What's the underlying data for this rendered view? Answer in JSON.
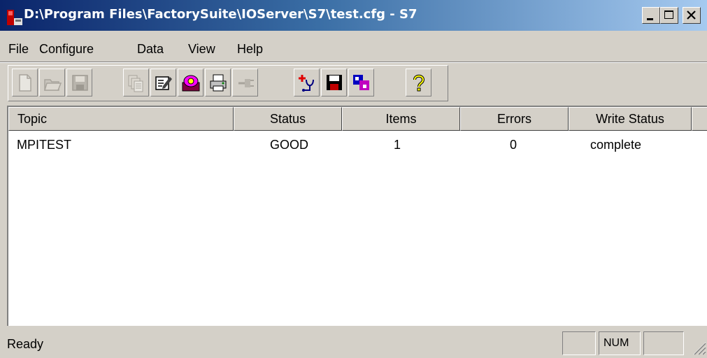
{
  "window": {
    "title": "D:\\Program Files\\FactorySuite\\IOServer\\S7\\test.cfg - S7",
    "app_icon": "app-icon",
    "controls": [
      "minimize-icon",
      "maximize-icon",
      "close-icon"
    ]
  },
  "menu": {
    "items": [
      {
        "label": "File"
      },
      {
        "label": "Configure"
      },
      {
        "label": "Data"
      },
      {
        "label": "View"
      },
      {
        "label": "Help"
      }
    ]
  },
  "toolbar": {
    "buttons": [
      {
        "icon": "new-document-icon",
        "enabled": false
      },
      {
        "icon": "open-folder-icon",
        "enabled": false
      },
      {
        "icon": "save-disk-icon",
        "enabled": false
      },
      {
        "icon": "topic-list-icon",
        "enabled": false
      },
      {
        "icon": "edit-icon",
        "enabled": true
      },
      {
        "icon": "server-settings-icon",
        "enabled": true
      },
      {
        "icon": "print-icon",
        "enabled": true
      },
      {
        "icon": "plug-icon",
        "enabled": false
      },
      {
        "icon": "diagnostics-icon",
        "enabled": true
      },
      {
        "icon": "save-config-icon",
        "enabled": true
      },
      {
        "icon": "data-block-icon",
        "enabled": true
      },
      {
        "icon": "help-icon",
        "enabled": true
      }
    ]
  },
  "table": {
    "columns": [
      "Topic",
      "Status",
      "Items",
      "Errors",
      "Write Status"
    ],
    "rows": [
      {
        "topic": "MPITEST",
        "status": "GOOD",
        "items": "1",
        "errors": "0",
        "write_status": "complete"
      }
    ]
  },
  "statusbar": {
    "text": "Ready",
    "num_indicator": "NUM"
  }
}
